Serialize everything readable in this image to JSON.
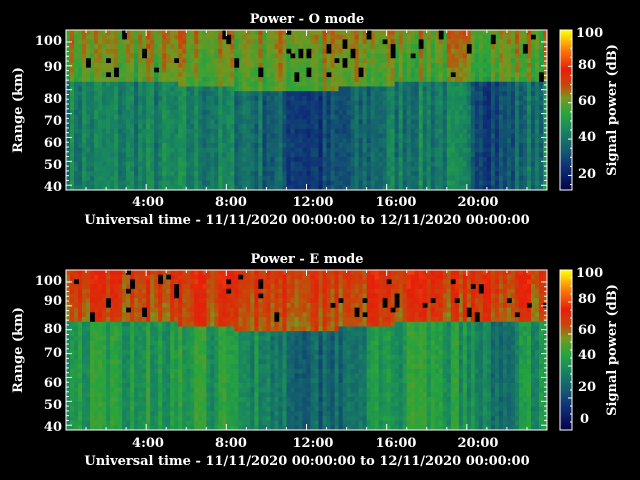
{
  "chart_data": [
    {
      "type": "heatmap",
      "title": "Power - O mode",
      "xlabel": "Universal time - 11/11/2020 00:00:00 to 12/11/2020 00:00:00",
      "ylabel": "Range (km)",
      "xlim_hours": [
        0,
        24
      ],
      "ylim": [
        38,
        105
      ],
      "x_ticks": [
        "4:00",
        "8:00",
        "12:00",
        "16:00",
        "20:00"
      ],
      "y_ticks": [
        "40",
        "50",
        "60",
        "70",
        "80",
        "90",
        "100"
      ],
      "colorbar": {
        "label": "Signal power (dB)",
        "min": 12,
        "max": 100,
        "ticks": [
          "20",
          "40",
          "60",
          "80",
          "100"
        ]
      },
      "profile_peak_db": 55,
      "profile_floor_db": 28,
      "upper_layer_db": 58
    },
    {
      "type": "heatmap",
      "title": "Power - E mode",
      "xlabel": "Universal time - 11/11/2020 00:00:00 to 12/11/2020 00:00:00",
      "ylabel": "Range (km)",
      "xlim_hours": [
        0,
        24
      ],
      "ylim": [
        38,
        105
      ],
      "x_ticks": [
        "4:00",
        "8:00",
        "12:00",
        "16:00",
        "20:00"
      ],
      "y_ticks": [
        "40",
        "50",
        "60",
        "70",
        "80",
        "90",
        "100"
      ],
      "colorbar": {
        "label": "Signal power (dB)",
        "min": 0,
        "max": 100,
        "ticks": [
          "0",
          "20",
          "40",
          "60",
          "80",
          "100"
        ]
      },
      "profile_peak_db": 62,
      "profile_floor_db": 22,
      "upper_layer_db": 66
    }
  ]
}
